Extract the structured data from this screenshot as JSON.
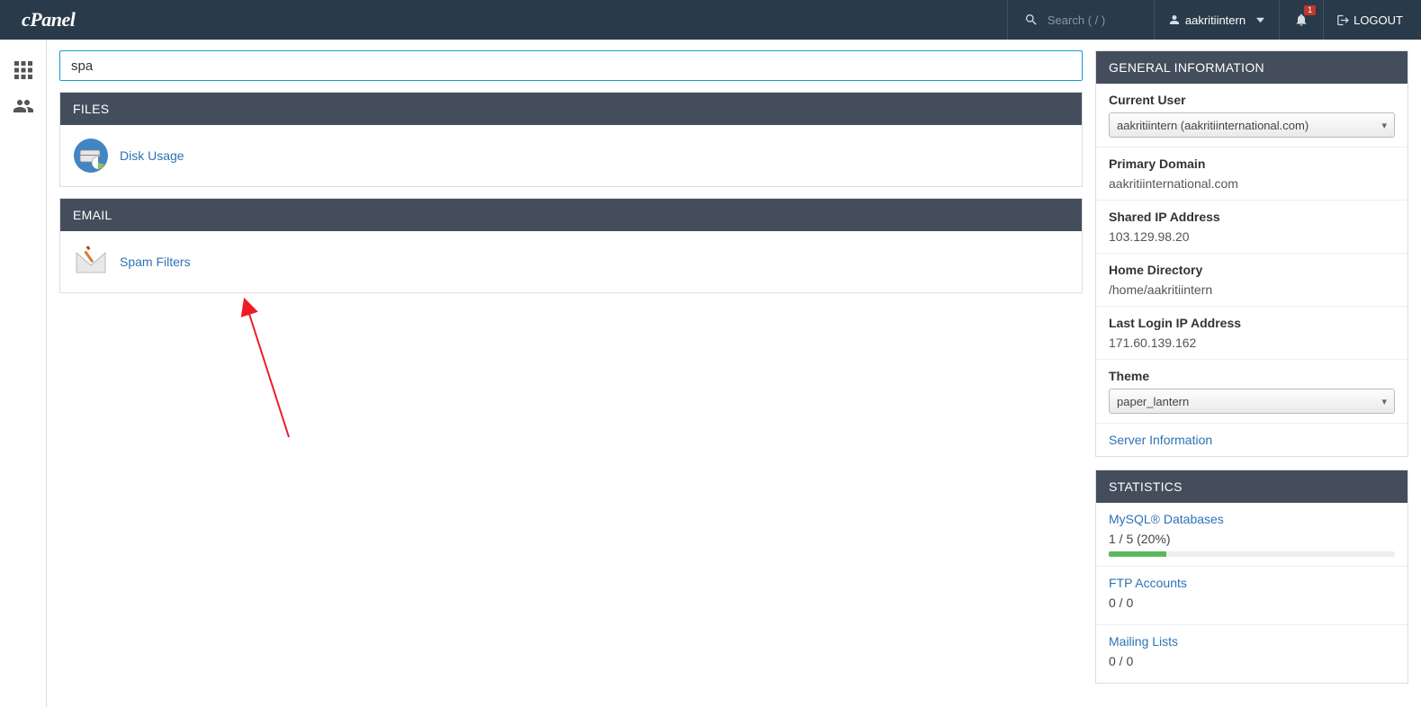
{
  "navbar": {
    "logo_text": "cPanel",
    "search_placeholder": "Search ( / )",
    "username": "aakritiintern",
    "bell_count": "1",
    "logout_label": "LOGOUT"
  },
  "filter_value": "spa",
  "groups": [
    {
      "title": "FILES",
      "items": [
        {
          "label": "Disk Usage",
          "icon": "disk-usage"
        }
      ]
    },
    {
      "title": "EMAIL",
      "items": [
        {
          "label": "Spam Filters",
          "icon": "spam-filters"
        }
      ]
    }
  ],
  "general_info": {
    "title": "GENERAL INFORMATION",
    "current_user_label": "Current User",
    "current_user_value": "aakritiintern (aakritiinternational.com)",
    "primary_domain_label": "Primary Domain",
    "primary_domain_value": "aakritiinternational.com",
    "shared_ip_label": "Shared IP Address",
    "shared_ip_value": "103.129.98.20",
    "home_dir_label": "Home Directory",
    "home_dir_value": "/home/aakritiintern",
    "last_login_label": "Last Login IP Address",
    "last_login_value": "171.60.139.162",
    "theme_label": "Theme",
    "theme_value": "paper_lantern",
    "server_info_link": "Server Information"
  },
  "statistics": {
    "title": "STATISTICS",
    "items": [
      {
        "title": "MySQL® Databases",
        "value": "1 / 5   (20%)",
        "percent": 20
      },
      {
        "title": "FTP Accounts",
        "value": "0 / 0",
        "percent": null
      },
      {
        "title": "Mailing Lists",
        "value": "0 / 0",
        "percent": null
      }
    ]
  }
}
